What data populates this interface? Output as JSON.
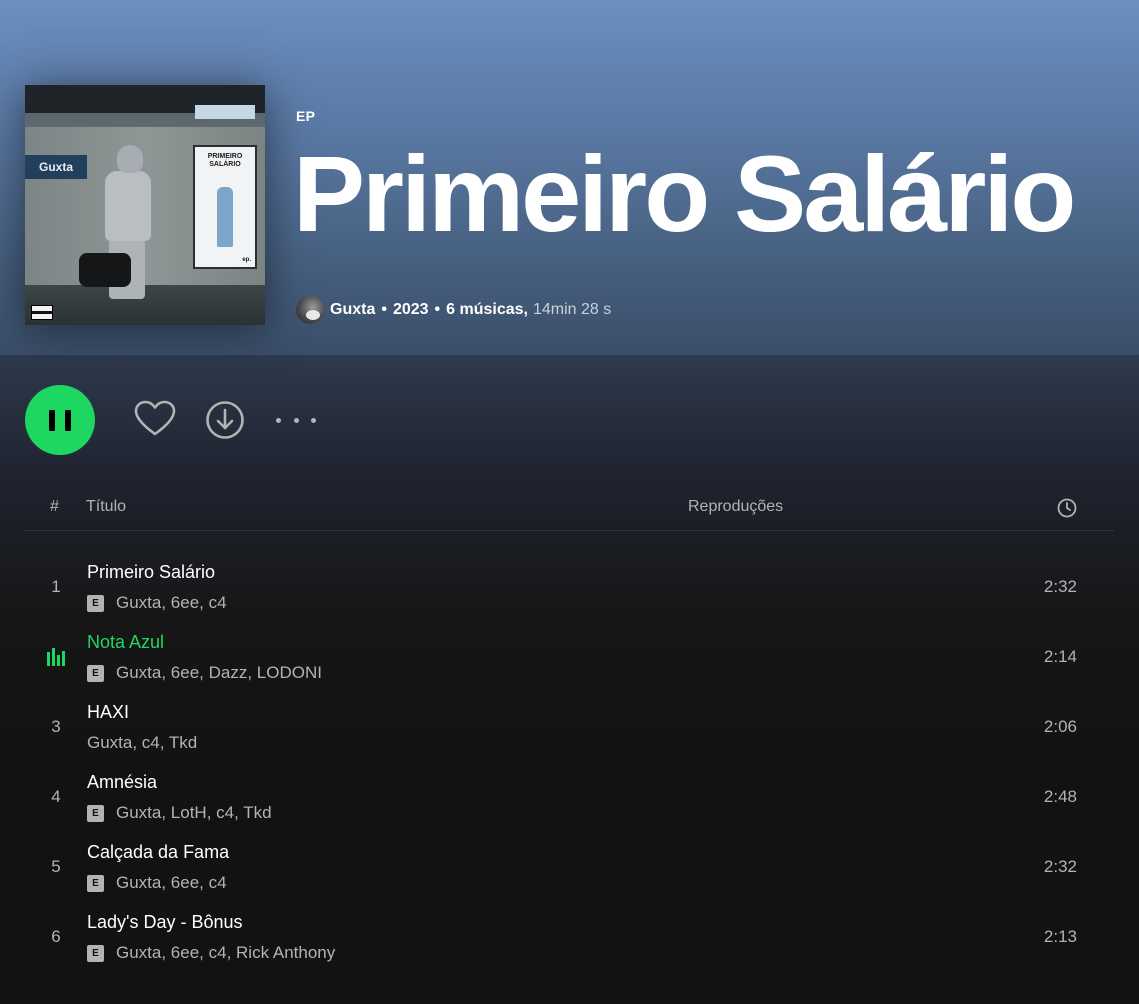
{
  "album": {
    "type_label": "EP",
    "title": "Primeiro Salário",
    "artist": "Guxta",
    "year": "2023",
    "track_count": "6 músicas,",
    "duration": "14min 28 s",
    "cover_sign_text": "Guxta",
    "cover_poster_title": "PRIMEIRO SALÁRIO",
    "cover_poster_ep": "ep."
  },
  "actions": {
    "play_state": "playing",
    "icons": [
      "pause-icon",
      "heart-icon",
      "download-icon",
      "more-icon"
    ]
  },
  "table_header": {
    "num": "#",
    "title": "Título",
    "plays": "Reproduções",
    "duration_icon": "clock-icon"
  },
  "tracks": [
    {
      "num": "1",
      "title": "Primeiro Salário",
      "artists": "Guxta, 6ee, c4",
      "explicit": true,
      "duration": "2:32",
      "playing": false
    },
    {
      "num": "2",
      "title": "Nota Azul",
      "artists": "Guxta, 6ee, Dazz, LODONI",
      "explicit": true,
      "duration": "2:14",
      "playing": true
    },
    {
      "num": "3",
      "title": "HAXI",
      "artists": "Guxta, c4, Tkd",
      "explicit": false,
      "duration": "2:06",
      "playing": false
    },
    {
      "num": "4",
      "title": "Amnésia",
      "artists": "Guxta, LotH, c4, Tkd",
      "explicit": true,
      "duration": "2:48",
      "playing": false
    },
    {
      "num": "5",
      "title": "Calçada da Fama",
      "artists": "Guxta, 6ee, c4",
      "explicit": true,
      "duration": "2:32",
      "playing": false
    },
    {
      "num": "6",
      "title": "Lady's Day - Bônus",
      "artists": "Guxta, 6ee, c4, Rick Anthony",
      "explicit": true,
      "duration": "2:13",
      "playing": false
    }
  ],
  "explicit_label": "E",
  "colors": {
    "accent": "#1ed760",
    "header_top": "#6b8fbf",
    "background": "#121212",
    "text_secondary": "#b3b3b3"
  }
}
